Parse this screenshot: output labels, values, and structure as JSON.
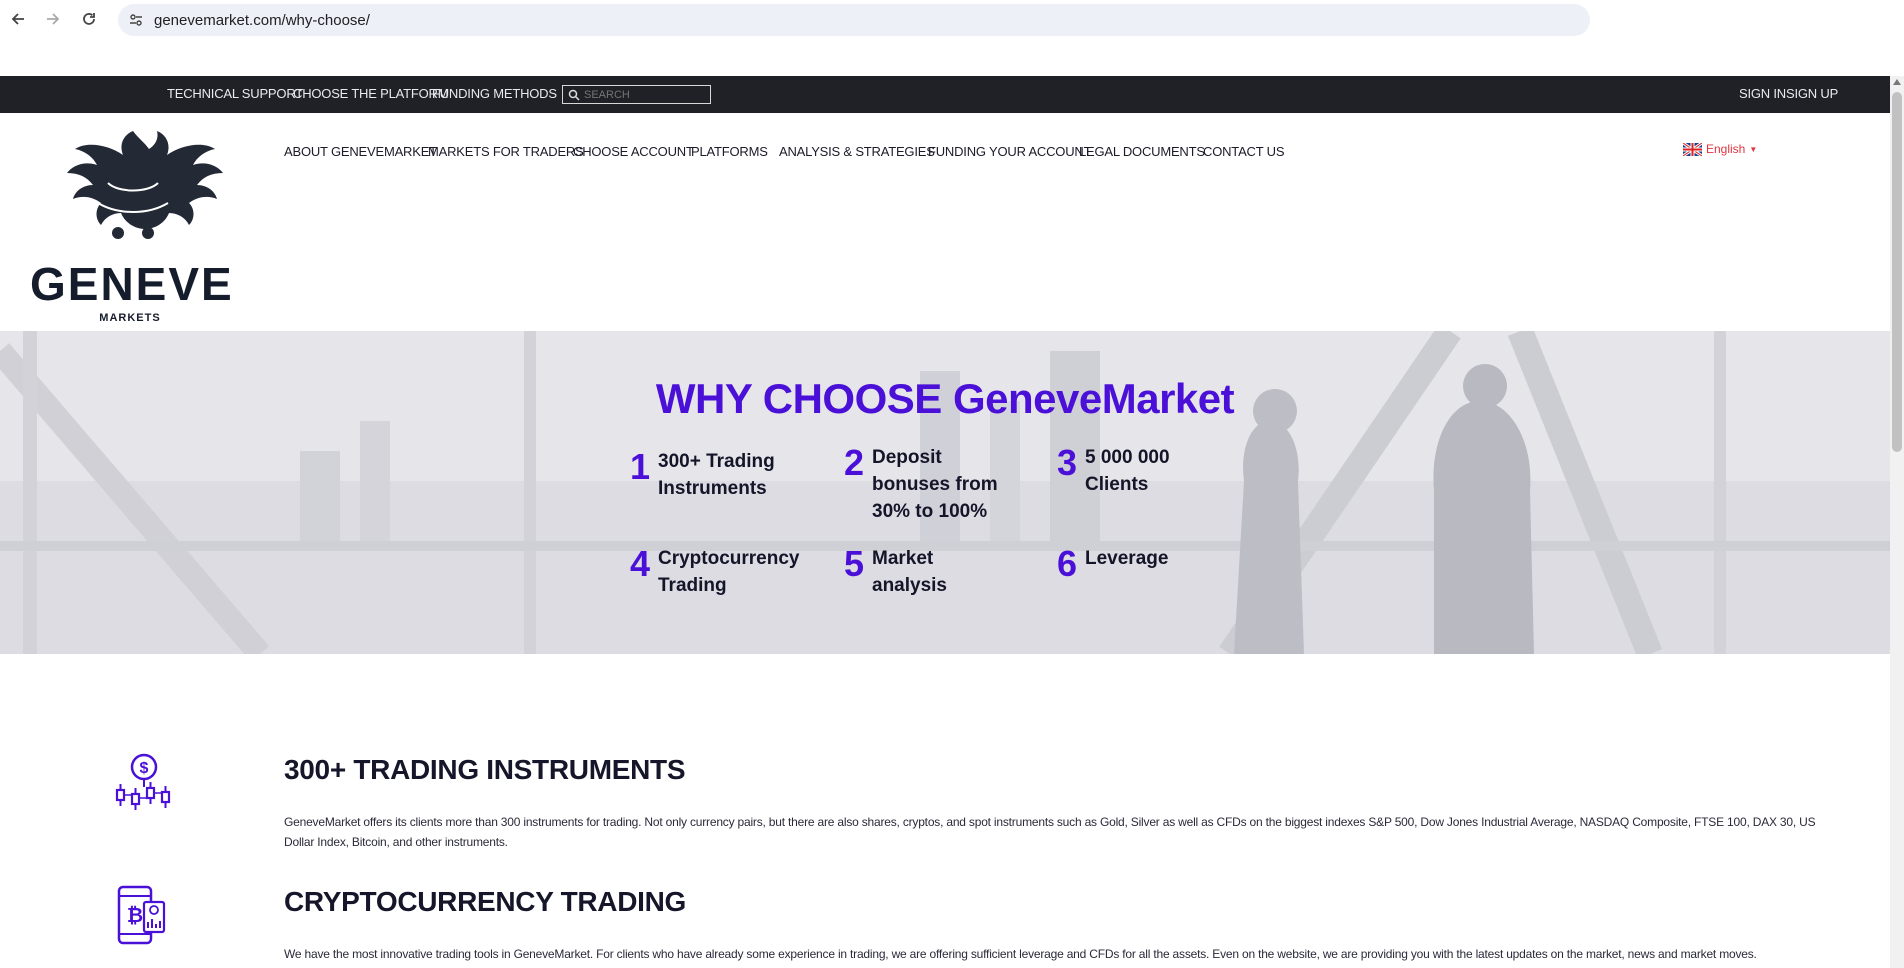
{
  "browser": {
    "url": "genevemarket.com/why-choose/"
  },
  "topbar": {
    "links": [
      "TECHNICAL SUPPORT",
      "CHOOSE THE PLATFORM",
      "FUNDING METHODS"
    ],
    "search_placeholder": "SEARCH",
    "auth": [
      "SIGN IN",
      "SIGN UP"
    ]
  },
  "logo": {
    "name": "GENEVE",
    "sub": "MARKETS"
  },
  "mainnav": {
    "items": [
      "ABOUT GENEVEMARKET",
      "MARKETS FOR TRADERS",
      "CHOOSE ACCOUNT",
      "PLATFORMS",
      "ANALYSIS & STRATEGIES",
      "FUNDING YOUR ACCOUNT",
      "LEGAL DOCUMENTS",
      "CONTACT US"
    ],
    "language": "English"
  },
  "hero": {
    "title": "WHY CHOOSE GeneveMarket",
    "features": [
      {
        "num": "1",
        "line1": "300+ Trading",
        "line2": "Instruments",
        "line3": ""
      },
      {
        "num": "2",
        "line1": "Deposit",
        "line2": "bonuses from",
        "line3": "30% to 100%"
      },
      {
        "num": "3",
        "line1": "5 000 000",
        "line2": "Clients",
        "line3": ""
      },
      {
        "num": "4",
        "line1": "Cryptocurrency",
        "line2": "Trading",
        "line3": ""
      },
      {
        "num": "5",
        "line1": "Market",
        "line2": "analysis",
        "line3": ""
      },
      {
        "num": "6",
        "line1": "Leverage",
        "line2": "",
        "line3": ""
      }
    ]
  },
  "sections": [
    {
      "title": "300+ TRADING INSTRUMENTS",
      "body": "GeneveMarket offers its clients more than 300 instruments for trading. Not only currency pairs, but there are also shares, cryptos, and spot instruments such as Gold, Silver as well as CFDs on the biggest indexes S&P 500, Dow Jones Industrial Average, NASDAQ Composite, FTSE 100, DAX 30, US Dollar Index, Bitcoin, and other instruments."
    },
    {
      "title": "CRYPTOCURRENCY TRADING",
      "body": "We have the most innovative trading tools in GeneveMarket. For clients who have already some experience in trading, we are offering sufficient leverage and CFDs for all the assets. Even on the website, we are providing you with the latest updates on the market, news and market moves."
    }
  ],
  "colors": {
    "accent": "#4a10d8",
    "topbar": "#202027",
    "lang": "#e0353f"
  }
}
